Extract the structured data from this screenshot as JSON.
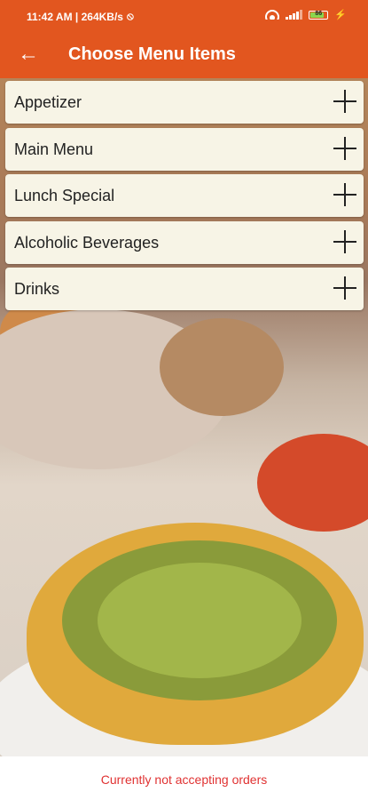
{
  "status_bar": {
    "time": "11:42 AM | 264KB/s",
    "battery": "86",
    "icons": [
      "wifi-icon",
      "signal-icon",
      "battery-icon",
      "charging-icon"
    ]
  },
  "app_bar": {
    "title": "Choose Menu Items",
    "back_icon": "arrow-left-icon",
    "background_color": "#e2561f"
  },
  "menu": {
    "items": [
      {
        "label": "Appetizer",
        "icon": "plus-icon"
      },
      {
        "label": "Main Menu",
        "icon": "plus-icon"
      },
      {
        "label": "Lunch Special",
        "icon": "plus-icon"
      },
      {
        "label": "Alcoholic Beverages",
        "icon": "plus-icon"
      },
      {
        "label": "Drinks",
        "icon": "plus-icon"
      }
    ]
  },
  "footer": {
    "message": "Currently not accepting orders",
    "color": "#e03232"
  }
}
